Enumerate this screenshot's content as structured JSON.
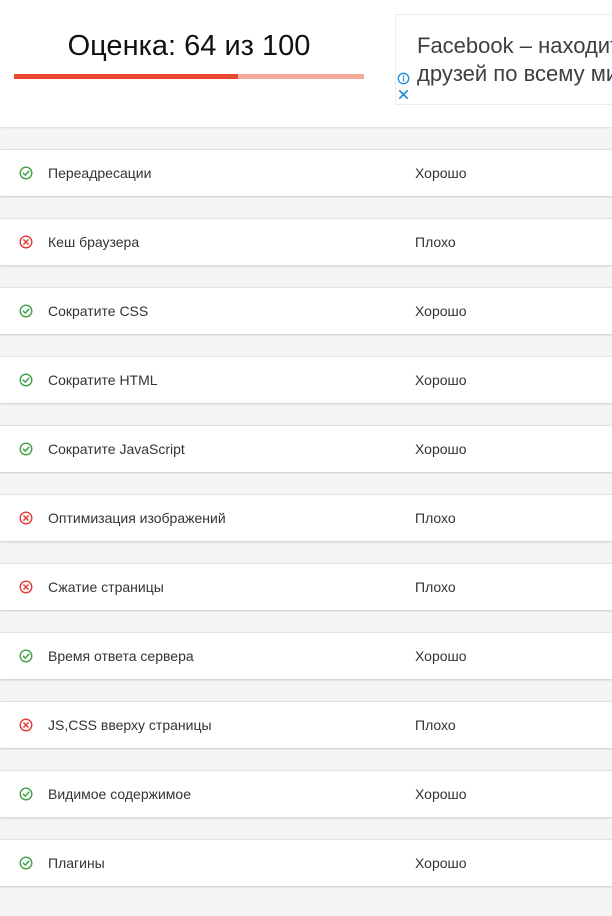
{
  "header": {
    "score_title": "Оценка: 64 из 100",
    "score_value": 64,
    "score_max": 100,
    "bar_fill_color": "#e8492f",
    "bar_track_color": "#f4a99a"
  },
  "ad": {
    "text": "Facebook – находите друзей по всему миру",
    "info_icon": "info-icon",
    "close_icon": "close-icon",
    "icon_color": "#1a8fd8"
  },
  "colors": {
    "good": "#43a047",
    "bad": "#e53935"
  },
  "checks": [
    {
      "name": "Переадресации",
      "status": "Хорошо",
      "result": "good"
    },
    {
      "name": "Кеш браузера",
      "status": "Плохо",
      "result": "bad"
    },
    {
      "name": "Сократите CSS",
      "status": "Хорошо",
      "result": "good"
    },
    {
      "name": "Сократите HTML",
      "status": "Хорошо",
      "result": "good"
    },
    {
      "name": "Сократите JavaScript",
      "status": "Хорошо",
      "result": "good"
    },
    {
      "name": "Оптимизация изображений",
      "status": "Плохо",
      "result": "bad"
    },
    {
      "name": "Сжатие страницы",
      "status": "Плохо",
      "result": "bad"
    },
    {
      "name": "Время ответа сервера",
      "status": "Хорошо",
      "result": "good"
    },
    {
      "name": "JS,CSS вверху страницы",
      "status": "Плохо",
      "result": "bad"
    },
    {
      "name": "Видимое содержимое",
      "status": "Хорошо",
      "result": "good"
    },
    {
      "name": "Плагины",
      "status": "Хорошо",
      "result": "good"
    }
  ]
}
